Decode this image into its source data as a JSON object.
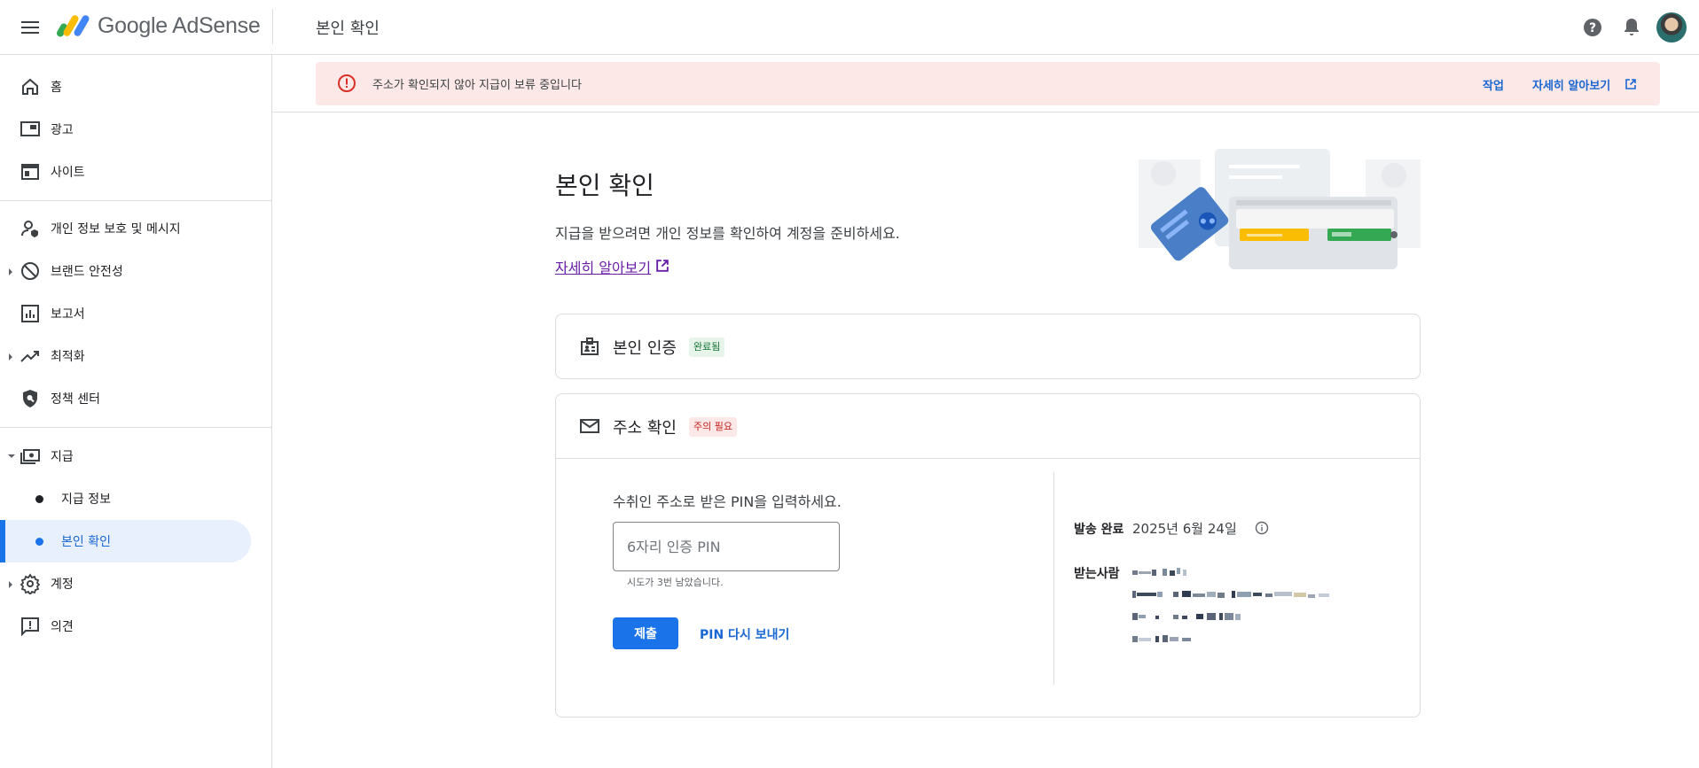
{
  "header": {
    "product_name": "Google AdSense",
    "page_title": "본인 확인"
  },
  "sidebar": {
    "items": [
      {
        "label": "홈",
        "icon": "home-icon"
      },
      {
        "label": "광고",
        "icon": "ads-icon"
      },
      {
        "label": "사이트",
        "icon": "sites-icon"
      },
      {
        "label": "개인 정보 보호 및 메시지",
        "icon": "privacy-icon"
      },
      {
        "label": "브랜드 안전성",
        "icon": "block-icon"
      },
      {
        "label": "보고서",
        "icon": "reports-icon"
      },
      {
        "label": "최적화",
        "icon": "trending-icon"
      },
      {
        "label": "정책 센터",
        "icon": "policy-shield-icon"
      },
      {
        "label": "지급",
        "icon": "payments-icon"
      },
      {
        "label": "계정",
        "icon": "gear-icon"
      },
      {
        "label": "의견",
        "icon": "feedback-icon"
      }
    ],
    "payments_sub": [
      {
        "label": "지급 정보"
      },
      {
        "label": "본인 확인"
      }
    ]
  },
  "banner": {
    "message": "주소가 확인되지 않아 지급이 보류 중입니다",
    "action": "작업",
    "learn_more": "자세히 알아보기"
  },
  "main": {
    "title": "본인 확인",
    "description": "지급을 받으려면 개인 정보를 확인하여 계정을 준비하세요.",
    "learn_more": "자세히 알아보기"
  },
  "identity_card": {
    "title": "본인 인증",
    "status": "완료됨"
  },
  "address_card": {
    "title": "주소 확인",
    "status": "주의 필요",
    "pin_prompt": "수취인 주소로 받은 PIN을 입력하세요.",
    "pin_placeholder": "6자리 인증 PIN",
    "attempts_hint": "시도가 3번 남았습니다.",
    "submit": "제출",
    "resend": "PIN 다시 보내기",
    "sent_label": "발송 완료",
    "sent_date": "2025년 6월 24일",
    "recipient_label": "받는사람"
  },
  "colors": {
    "accent": "#1a73e8",
    "error_bg": "#fce8e6",
    "error": "#d93025",
    "success_bg": "#e6f4ea",
    "success": "#137333",
    "link_visited": "#681da8"
  }
}
